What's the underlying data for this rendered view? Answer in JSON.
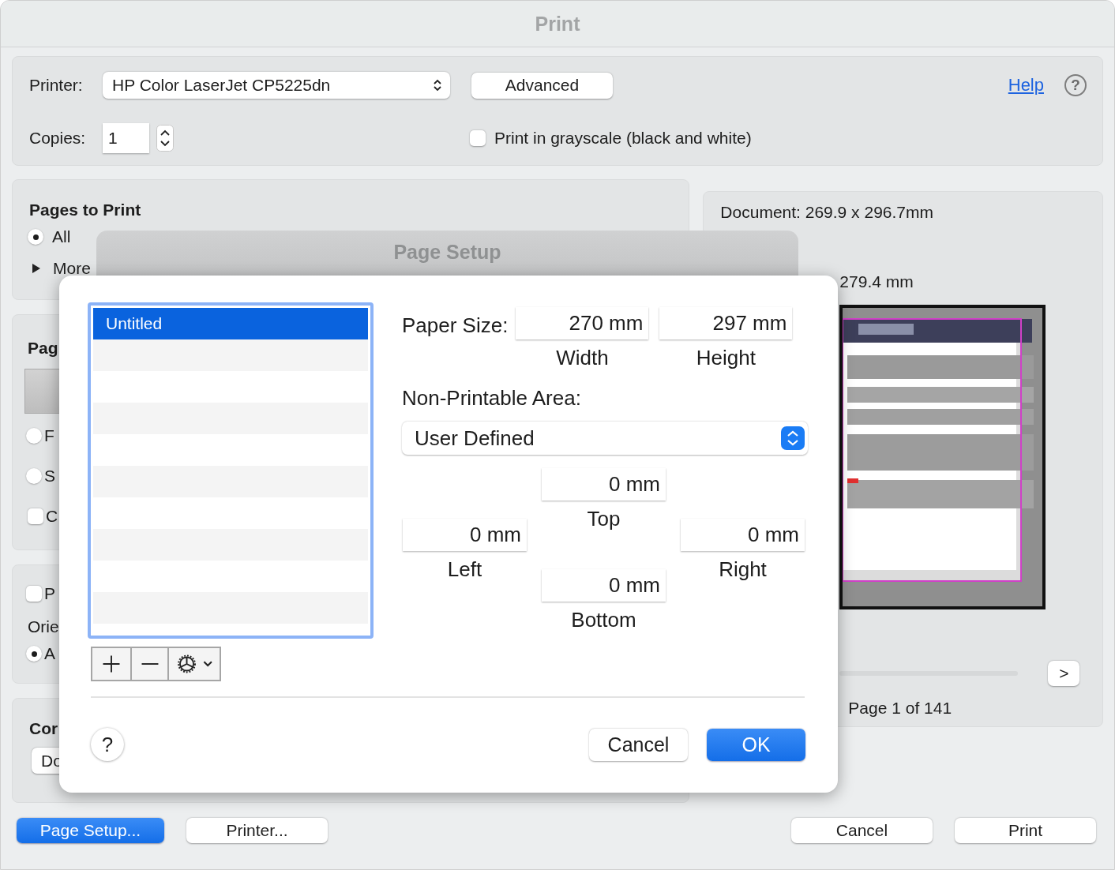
{
  "window": {
    "title": "Print"
  },
  "printer": {
    "label": "Printer:",
    "value": "HP Color LaserJet CP5225dn"
  },
  "advanced_button": "Advanced",
  "help_link": "Help",
  "help_icon": "?",
  "copies": {
    "label": "Copies:",
    "value": "1"
  },
  "grayscale": {
    "label": "Print in grayscale (black and white)",
    "checked": false
  },
  "pages_to_print": {
    "title": "Pages to Print",
    "options": [
      {
        "label": "All",
        "selected": true
      }
    ],
    "more": "More"
  },
  "panel_2": {
    "title": "Pag",
    "radios": [
      {
        "label": "F",
        "selected": false
      },
      {
        "label": "S",
        "selected": false
      }
    ],
    "checkbox": {
      "label": "C",
      "checked": false
    }
  },
  "panel_3": {
    "checkbox": {
      "label": "P",
      "checked": false
    },
    "orientation_label": "Orie",
    "radios": [
      {
        "label": "A",
        "selected": true
      }
    ]
  },
  "panel_4": {
    "title": "Cor",
    "button": "Do"
  },
  "preview": {
    "document_size": "Document: 269.9 x 296.7mm",
    "paper_size": "279.4 mm",
    "next_button": ">",
    "page_label": "Page 1 of 141"
  },
  "buttons": [
    {
      "label": "Page Setup...",
      "primary": true
    },
    {
      "label": "Printer...",
      "primary": false
    },
    {
      "label": "Cancel",
      "primary": false
    },
    {
      "label": "Print",
      "primary": false
    }
  ],
  "page_setup": {
    "title": "Page Setup",
    "presets": [
      {
        "label": "Untitled",
        "selected": true
      }
    ],
    "paper_size": {
      "label": "Paper Size:",
      "width": {
        "value": "270 mm",
        "label": "Width"
      },
      "height": {
        "value": "297 mm",
        "label": "Height"
      }
    },
    "non_printable": {
      "label": "Non-Printable Area:",
      "value": "User Defined"
    },
    "margins": {
      "top": {
        "value": "0 mm",
        "label": "Top"
      },
      "left": {
        "value": "0 mm",
        "label": "Left"
      },
      "right": {
        "value": "0 mm",
        "label": "Right"
      },
      "bottom": {
        "value": "0 mm",
        "label": "Bottom"
      }
    },
    "help_icon": "?",
    "buttons": [
      {
        "label": "Cancel",
        "primary": false
      },
      {
        "label": "OK",
        "primary": true
      }
    ]
  }
}
